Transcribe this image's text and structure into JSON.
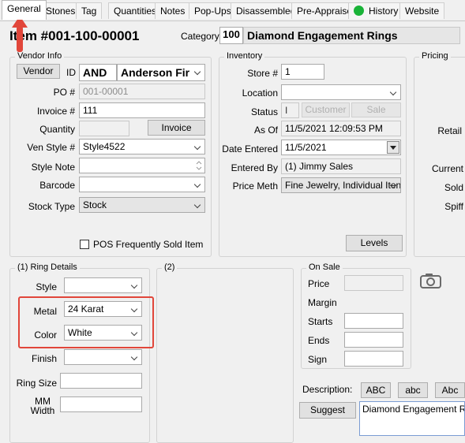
{
  "tabs": [
    {
      "label": "General",
      "active": true
    },
    {
      "label": "Stones"
    },
    {
      "label": "Tag"
    },
    {
      "label": "Quantities"
    },
    {
      "label": "Notes"
    },
    {
      "label": "Pop-Ups"
    },
    {
      "label": "Disassembled"
    },
    {
      "label": "Pre-Appraise"
    },
    {
      "label": "History"
    },
    {
      "label": "Website"
    }
  ],
  "header": {
    "item_title": "Item #001-100-00001",
    "category_label": "Category",
    "category_code": "100",
    "category_name": "Diamond Engagement Rings"
  },
  "vendor_info": {
    "legend": "Vendor Info",
    "vendor_button": "Vendor",
    "id_label": "ID",
    "id_value": "AND",
    "vendor_name": "Anderson Fir",
    "po_label": "PO #",
    "po_value": "001-00001",
    "invoice_label": "Invoice #",
    "invoice_value": "111",
    "quantity_label": "Quantity",
    "quantity_value": "",
    "invoice_button": "Invoice",
    "ven_style_label": "Ven Style #",
    "ven_style_value": "Style4522",
    "style_note_label": "Style Note",
    "style_note_value": "",
    "barcode_label": "Barcode",
    "barcode_value": "",
    "stock_type_label": "Stock Type",
    "stock_type_value": "Stock",
    "pos_checkbox_label": "POS Frequently Sold Item"
  },
  "inventory": {
    "legend": "Inventory",
    "store_label": "Store #",
    "store_value": "1",
    "location_label": "Location",
    "location_value": "",
    "status_label": "Status",
    "status_value": "I",
    "customer_button": "Customer",
    "sale_button": "Sale",
    "as_of_label": "As Of",
    "as_of_value": "11/5/2021 12:09:53 PM",
    "date_entered_label": "Date Entered",
    "date_entered_value": "11/5/2021",
    "entered_by_label": "Entered By",
    "entered_by_value": "(1) Jimmy Sales",
    "price_meth_label": "Price Meth",
    "price_meth_value": "Fine Jewelry, Individual Iten",
    "levels_button": "Levels"
  },
  "pricing": {
    "legend": "Pricing",
    "retail_label": "Retail",
    "current_label": "Current",
    "sold_label": "Sold",
    "spiff_label": "Spiff"
  },
  "ring_details": {
    "legend": "(1) Ring Details",
    "style_label": "Style",
    "style_value": "",
    "metal_label": "Metal",
    "metal_value": "24 Karat",
    "color_label": "Color",
    "color_value": "White",
    "finish_label": "Finish",
    "finish_value": "",
    "ring_size_label": "Ring Size",
    "ring_size_value": "",
    "mm_width_label": "MM Width",
    "mm_width_value": ""
  },
  "group2": {
    "legend": "(2)"
  },
  "on_sale": {
    "legend": "On Sale",
    "price_label": "Price",
    "margin_label": "Margin",
    "starts_label": "Starts",
    "ends_label": "Ends",
    "sign_label": "Sign"
  },
  "description": {
    "label": "Description:",
    "btn_upper": "ABC",
    "btn_lower": "abc",
    "btn_title": "Abc",
    "suggest_button": "Suggest",
    "value": "Diamond Engagement Ring"
  },
  "colors": {
    "accent_red": "#e1463a",
    "status_green": "#19b338"
  }
}
